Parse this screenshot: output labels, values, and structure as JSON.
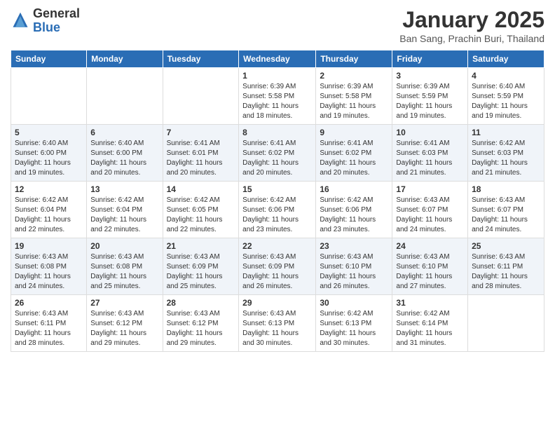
{
  "header": {
    "logo_general": "General",
    "logo_blue": "Blue",
    "month_title": "January 2025",
    "location": "Ban Sang, Prachin Buri, Thailand"
  },
  "days_of_week": [
    "Sunday",
    "Monday",
    "Tuesday",
    "Wednesday",
    "Thursday",
    "Friday",
    "Saturday"
  ],
  "weeks": [
    [
      {
        "day": "",
        "info": ""
      },
      {
        "day": "",
        "info": ""
      },
      {
        "day": "",
        "info": ""
      },
      {
        "day": "1",
        "info": "Sunrise: 6:39 AM\nSunset: 5:58 PM\nDaylight: 11 hours and 18 minutes."
      },
      {
        "day": "2",
        "info": "Sunrise: 6:39 AM\nSunset: 5:58 PM\nDaylight: 11 hours and 19 minutes."
      },
      {
        "day": "3",
        "info": "Sunrise: 6:39 AM\nSunset: 5:59 PM\nDaylight: 11 hours and 19 minutes."
      },
      {
        "day": "4",
        "info": "Sunrise: 6:40 AM\nSunset: 5:59 PM\nDaylight: 11 hours and 19 minutes."
      }
    ],
    [
      {
        "day": "5",
        "info": "Sunrise: 6:40 AM\nSunset: 6:00 PM\nDaylight: 11 hours and 19 minutes."
      },
      {
        "day": "6",
        "info": "Sunrise: 6:40 AM\nSunset: 6:00 PM\nDaylight: 11 hours and 20 minutes."
      },
      {
        "day": "7",
        "info": "Sunrise: 6:41 AM\nSunset: 6:01 PM\nDaylight: 11 hours and 20 minutes."
      },
      {
        "day": "8",
        "info": "Sunrise: 6:41 AM\nSunset: 6:02 PM\nDaylight: 11 hours and 20 minutes."
      },
      {
        "day": "9",
        "info": "Sunrise: 6:41 AM\nSunset: 6:02 PM\nDaylight: 11 hours and 20 minutes."
      },
      {
        "day": "10",
        "info": "Sunrise: 6:41 AM\nSunset: 6:03 PM\nDaylight: 11 hours and 21 minutes."
      },
      {
        "day": "11",
        "info": "Sunrise: 6:42 AM\nSunset: 6:03 PM\nDaylight: 11 hours and 21 minutes."
      }
    ],
    [
      {
        "day": "12",
        "info": "Sunrise: 6:42 AM\nSunset: 6:04 PM\nDaylight: 11 hours and 22 minutes."
      },
      {
        "day": "13",
        "info": "Sunrise: 6:42 AM\nSunset: 6:04 PM\nDaylight: 11 hours and 22 minutes."
      },
      {
        "day": "14",
        "info": "Sunrise: 6:42 AM\nSunset: 6:05 PM\nDaylight: 11 hours and 22 minutes."
      },
      {
        "day": "15",
        "info": "Sunrise: 6:42 AM\nSunset: 6:06 PM\nDaylight: 11 hours and 23 minutes."
      },
      {
        "day": "16",
        "info": "Sunrise: 6:42 AM\nSunset: 6:06 PM\nDaylight: 11 hours and 23 minutes."
      },
      {
        "day": "17",
        "info": "Sunrise: 6:43 AM\nSunset: 6:07 PM\nDaylight: 11 hours and 24 minutes."
      },
      {
        "day": "18",
        "info": "Sunrise: 6:43 AM\nSunset: 6:07 PM\nDaylight: 11 hours and 24 minutes."
      }
    ],
    [
      {
        "day": "19",
        "info": "Sunrise: 6:43 AM\nSunset: 6:08 PM\nDaylight: 11 hours and 24 minutes."
      },
      {
        "day": "20",
        "info": "Sunrise: 6:43 AM\nSunset: 6:08 PM\nDaylight: 11 hours and 25 minutes."
      },
      {
        "day": "21",
        "info": "Sunrise: 6:43 AM\nSunset: 6:09 PM\nDaylight: 11 hours and 25 minutes."
      },
      {
        "day": "22",
        "info": "Sunrise: 6:43 AM\nSunset: 6:09 PM\nDaylight: 11 hours and 26 minutes."
      },
      {
        "day": "23",
        "info": "Sunrise: 6:43 AM\nSunset: 6:10 PM\nDaylight: 11 hours and 26 minutes."
      },
      {
        "day": "24",
        "info": "Sunrise: 6:43 AM\nSunset: 6:10 PM\nDaylight: 11 hours and 27 minutes."
      },
      {
        "day": "25",
        "info": "Sunrise: 6:43 AM\nSunset: 6:11 PM\nDaylight: 11 hours and 28 minutes."
      }
    ],
    [
      {
        "day": "26",
        "info": "Sunrise: 6:43 AM\nSunset: 6:11 PM\nDaylight: 11 hours and 28 minutes."
      },
      {
        "day": "27",
        "info": "Sunrise: 6:43 AM\nSunset: 6:12 PM\nDaylight: 11 hours and 29 minutes."
      },
      {
        "day": "28",
        "info": "Sunrise: 6:43 AM\nSunset: 6:12 PM\nDaylight: 11 hours and 29 minutes."
      },
      {
        "day": "29",
        "info": "Sunrise: 6:43 AM\nSunset: 6:13 PM\nDaylight: 11 hours and 30 minutes."
      },
      {
        "day": "30",
        "info": "Sunrise: 6:42 AM\nSunset: 6:13 PM\nDaylight: 11 hours and 30 minutes."
      },
      {
        "day": "31",
        "info": "Sunrise: 6:42 AM\nSunset: 6:14 PM\nDaylight: 11 hours and 31 minutes."
      },
      {
        "day": "",
        "info": ""
      }
    ]
  ]
}
